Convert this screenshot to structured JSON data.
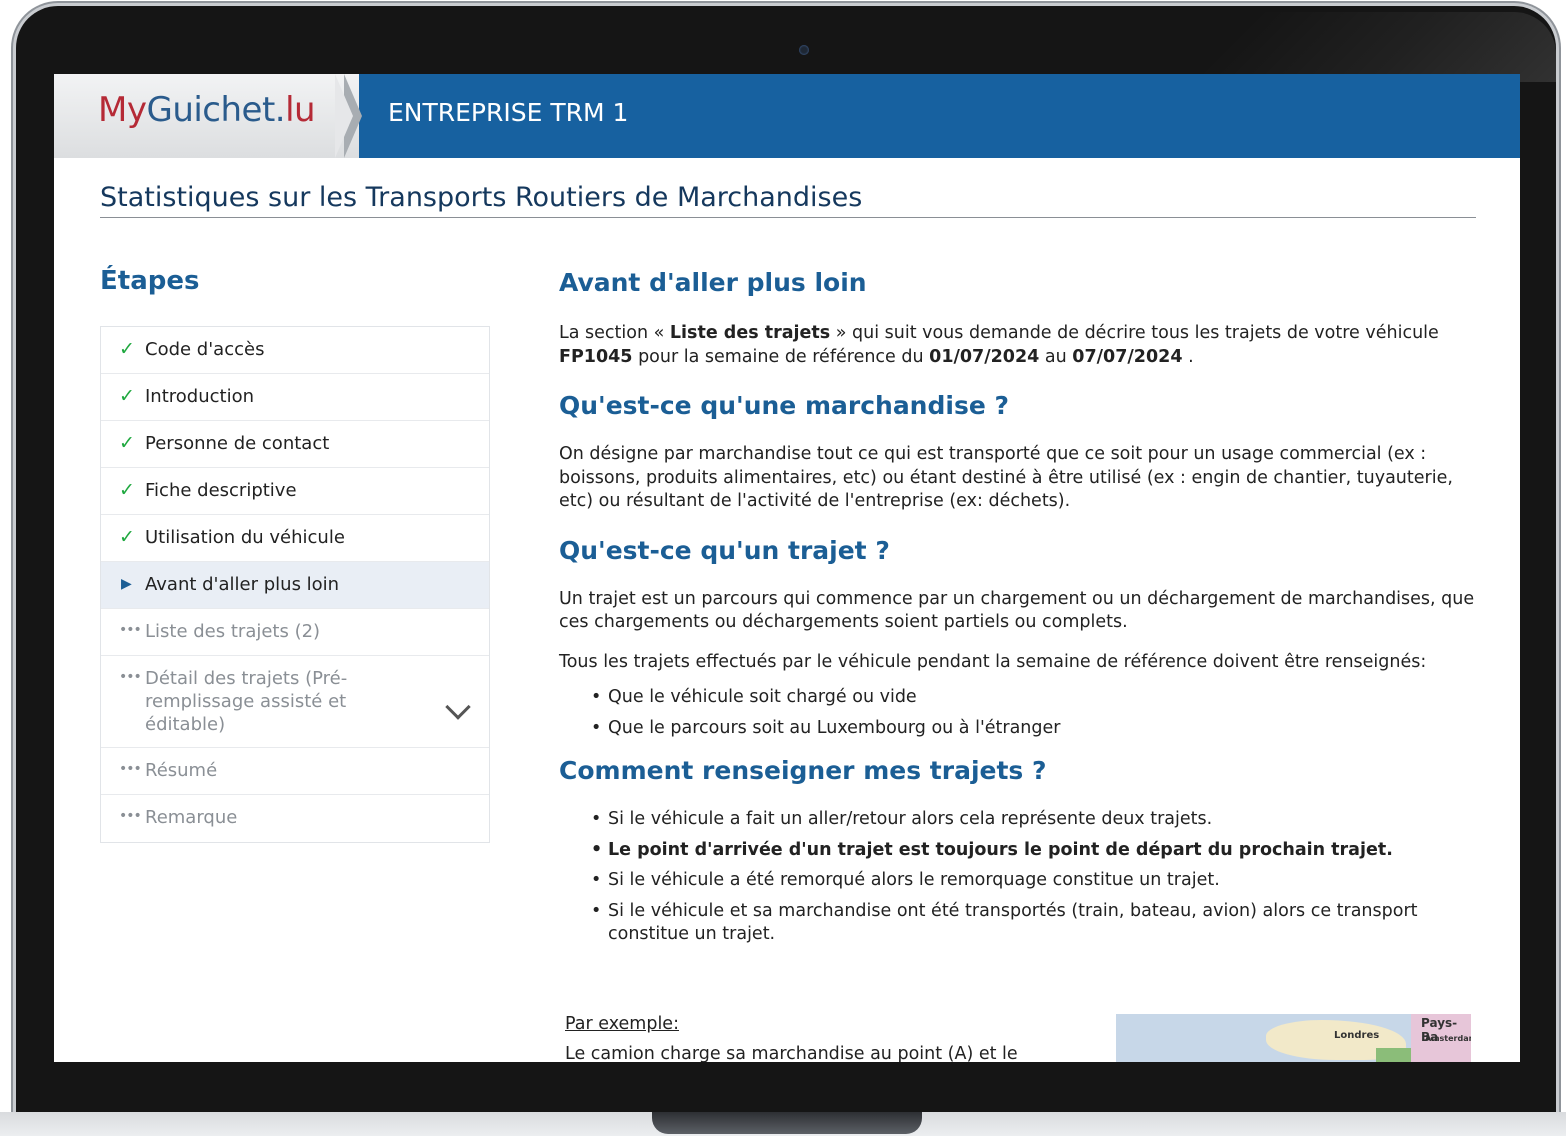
{
  "header": {
    "logo_my": "My",
    "logo_guichet": "Guichet.",
    "logo_lu": "lu",
    "company": "ENTREPRISE TRM 1"
  },
  "page_title": "Statistiques sur les Transports Routiers de Marchandises",
  "sidebar": {
    "title": "Étapes",
    "steps": [
      {
        "label": "Code d'accès",
        "status": "done"
      },
      {
        "label": "Introduction",
        "status": "done"
      },
      {
        "label": "Personne de contact",
        "status": "done"
      },
      {
        "label": "Fiche descriptive",
        "status": "done"
      },
      {
        "label": "Utilisation du véhicule",
        "status": "done"
      },
      {
        "label": "Avant d'aller plus loin",
        "status": "current"
      },
      {
        "label": "Liste des trajets (2)",
        "status": "pending"
      },
      {
        "label": "Détail des trajets (Pré-remplissage assisté et éditable)",
        "status": "pending"
      },
      {
        "label": "Résumé",
        "status": "pending"
      },
      {
        "label": "Remarque",
        "status": "pending"
      }
    ]
  },
  "main": {
    "heading": "Avant d'aller plus loin",
    "intro": {
      "t1": "La section « ",
      "b1": "Liste des trajets",
      "t2": " » qui suit vous demande de décrire tous les trajets de votre véhicule ",
      "b2": "FP1045",
      "t3": " pour la semaine de référence du ",
      "b3": "01/07/2024",
      "t4": " au ",
      "b4": "07/07/2024",
      "t5": " ."
    },
    "marchandise": {
      "heading": "Qu'est-ce qu'une marchandise ?",
      "text": "On désigne par marchandise tout ce qui est transporté que ce soit pour un usage commercial (ex : boissons, produits alimentaires, etc) ou étant destiné à être utilisé (ex : engin de chantier, tuyauterie, etc) ou résultant de l'activité de l'entreprise (ex: déchets)."
    },
    "trajet": {
      "heading": "Qu'est-ce qu'un trajet ?",
      "text1": "Un trajet est un parcours qui commence par un chargement ou un déchargement de marchandises, que ces chargements ou déchargements soient partiels ou complets.",
      "text2": "Tous les trajets effectués par le véhicule pendant la semaine de référence doivent être renseignés:",
      "bullets": [
        "Que le véhicule soit chargé ou vide",
        "Que le parcours soit au Luxembourg ou à l'étranger"
      ]
    },
    "renseigner": {
      "heading": "Comment renseigner mes trajets ?",
      "bullets": [
        "Si le véhicule a fait un aller/retour alors cela représente deux trajets.",
        "Le point d'arrivée d'un trajet est toujours le point de départ du prochain trajet.",
        "Si le véhicule a été remorqué alors le remorquage constitue un trajet.",
        "Si le véhicule et sa marchandise ont été transportés (train, bateau, avion) alors ce transport constitue un trajet."
      ]
    },
    "example_label": "Par exemple:",
    "example_text": "Le camion charge sa marchandise au point (A) et le",
    "map_labels": {
      "londres": "Londres",
      "paysbas": "Pays-Ba",
      "amsterdam": "Amsterdan"
    }
  },
  "colors": {
    "brand_blue": "#1761a0",
    "heading_blue": "#1b5e95",
    "check_green": "#1fa83f",
    "logo_red": "#b52a36"
  }
}
